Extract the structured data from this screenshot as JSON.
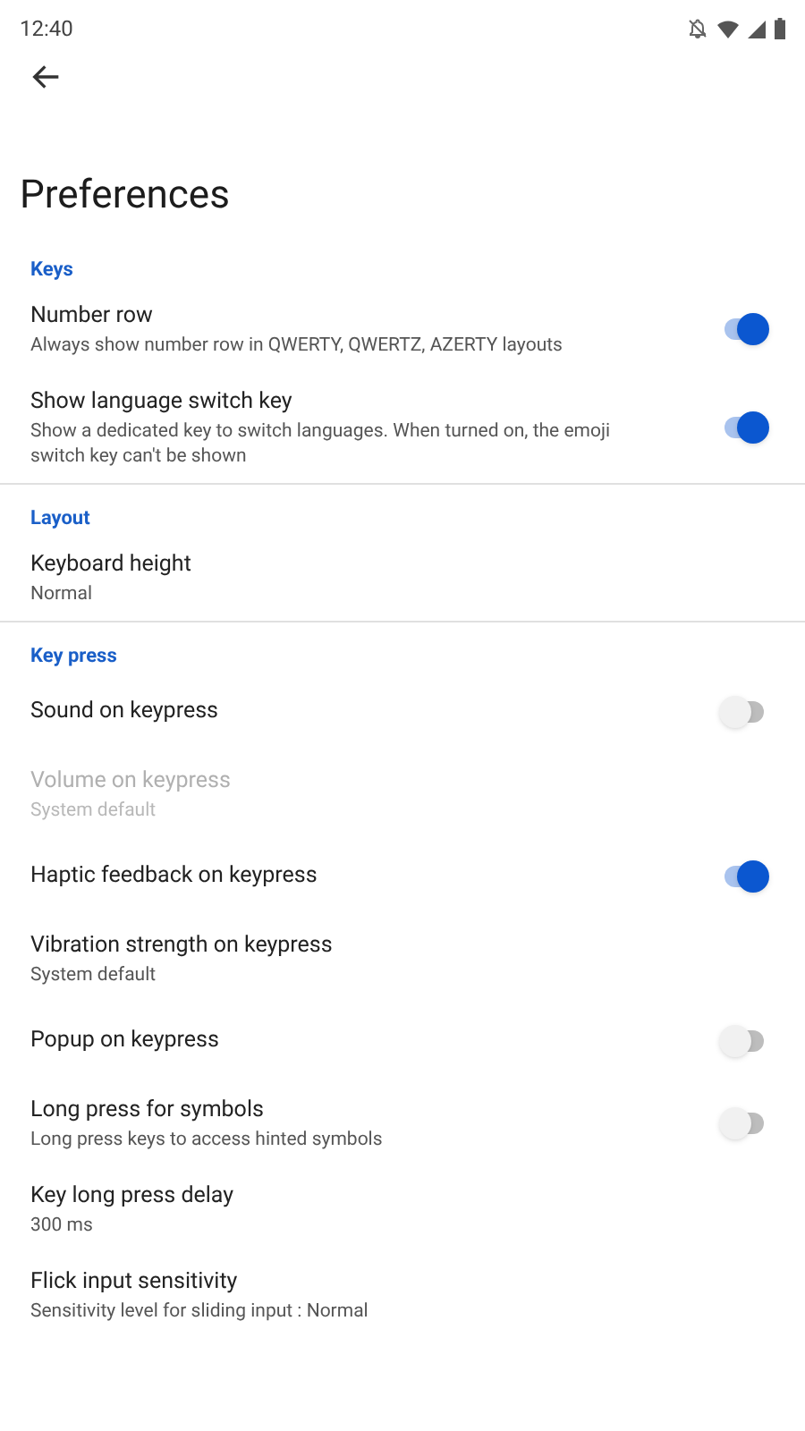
{
  "status_bar": {
    "time": "12:40"
  },
  "title": "Preferences",
  "sections": [
    {
      "header": "Keys",
      "items": [
        {
          "kind": "switch",
          "title": "Number row",
          "summary": "Always show number row in QWERTY, QWERTZ, AZERTY layouts",
          "on": true,
          "disabled": false
        },
        {
          "kind": "switch",
          "title": "Show language switch key",
          "summary": "Show a dedicated key to switch languages. When turned on, the emoji switch key can't be shown",
          "on": true,
          "disabled": false
        }
      ]
    },
    {
      "header": "Layout",
      "items": [
        {
          "kind": "plain",
          "title": "Keyboard height",
          "summary": "Normal",
          "disabled": false
        }
      ]
    },
    {
      "header": "Key press",
      "items": [
        {
          "kind": "switch",
          "title": "Sound on keypress",
          "on": false,
          "disabled": false
        },
        {
          "kind": "plain",
          "title": "Volume on keypress",
          "summary": "System default",
          "disabled": true
        },
        {
          "kind": "switch",
          "title": "Haptic feedback on keypress",
          "on": true,
          "disabled": false
        },
        {
          "kind": "plain",
          "title": "Vibration strength on keypress",
          "summary": "System default",
          "disabled": false
        },
        {
          "kind": "switch",
          "title": "Popup on keypress",
          "on": false,
          "disabled": false
        },
        {
          "kind": "switch",
          "title": "Long press for symbols",
          "summary": "Long press keys to access hinted symbols",
          "on": false,
          "disabled": false
        },
        {
          "kind": "plain",
          "title": "Key long press delay",
          "summary": "300 ms",
          "disabled": false
        },
        {
          "kind": "plain",
          "title": "Flick input sensitivity",
          "summary": "Sensitivity level for sliding input : Normal",
          "disabled": false
        }
      ]
    }
  ]
}
